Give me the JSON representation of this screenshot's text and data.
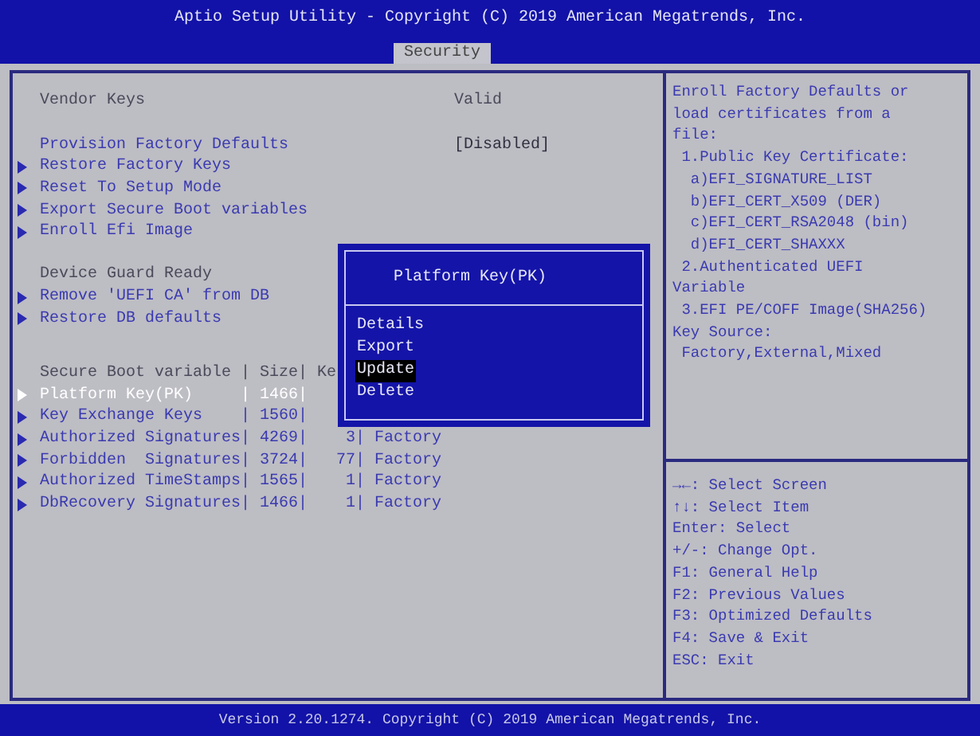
{
  "header": {
    "title": "Aptio Setup Utility - Copyright (C) 2019 American Megatrends, Inc.",
    "tabs": [
      {
        "label": "Security",
        "selected": true
      }
    ]
  },
  "sections": [
    {
      "items": [
        {
          "kind": "info",
          "label": "Vendor Keys",
          "value": "Valid",
          "selected": false
        }
      ]
    },
    {
      "items": [
        {
          "kind": "setting",
          "label": "Provision Factory Defaults",
          "value": "[Disabled]",
          "selected": false
        },
        {
          "kind": "submenu",
          "label": "Restore Factory Keys",
          "selected": false
        },
        {
          "kind": "submenu",
          "label": "Reset To Setup Mode",
          "selected": false
        },
        {
          "kind": "submenu",
          "label": "Export Secure Boot variables",
          "selected": false
        },
        {
          "kind": "submenu",
          "label": "Enroll Efi Image",
          "selected": false
        }
      ]
    },
    {
      "items": [
        {
          "kind": "info",
          "label": "Device Guard Ready",
          "selected": false
        },
        {
          "kind": "submenu",
          "label": "Remove 'UEFI CA' from DB",
          "selected": false
        },
        {
          "kind": "submenu",
          "label": "Restore DB defaults",
          "selected": false
        }
      ]
    },
    {
      "items": [
        {
          "kind": "info",
          "label": "Secure Boot variable | Size| Ke",
          "selected": false
        },
        {
          "kind": "submenu",
          "label": "Platform Key(PK)     | 1466|",
          "selected": true
        },
        {
          "kind": "submenu",
          "label": "Key Exchange Keys    | 1560|",
          "selected": false
        },
        {
          "kind": "submenu",
          "label": "Authorized Signatures| 4269|    3| Factory",
          "selected": false
        },
        {
          "kind": "submenu",
          "label": "Forbidden  Signatures| 3724|   77| Factory",
          "selected": false
        },
        {
          "kind": "submenu",
          "label": "Authorized TimeStamps| 1565|    1| Factory",
          "selected": false
        },
        {
          "kind": "submenu",
          "label": "DbRecovery Signatures| 1466|    1| Factory",
          "selected": false
        }
      ]
    }
  ],
  "popup": {
    "title": "Platform Key(PK)",
    "options": [
      {
        "label": "Details",
        "selected": false
      },
      {
        "label": "Export",
        "selected": false
      },
      {
        "label": "Update",
        "selected": true
      },
      {
        "label": "Delete",
        "selected": false
      }
    ]
  },
  "help_text": [
    "Enroll Factory Defaults or",
    "load certificates from a",
    "file:",
    " 1.Public Key Certificate:",
    "  a)EFI_SIGNATURE_LIST",
    "  b)EFI_CERT_X509 (DER)",
    "  c)EFI_CERT_RSA2048 (bin)",
    "  d)EFI_CERT_SHAXXX",
    " 2.Authenticated UEFI",
    "Variable",
    " 3.EFI PE/COFF Image(SHA256)",
    "Key Source:",
    " Factory,External,Mixed"
  ],
  "key_help": [
    "→←: Select Screen",
    "↑↓: Select Item",
    "Enter: Select",
    "+/-: Change Opt.",
    "F1: General Help",
    "F2: Previous Values",
    "F3: Optimized Defaults",
    "F4: Save & Exit",
    "ESC: Exit"
  ],
  "footer": "Version 2.20.1274. Copyright (C) 2019 American Megatrends, Inc."
}
